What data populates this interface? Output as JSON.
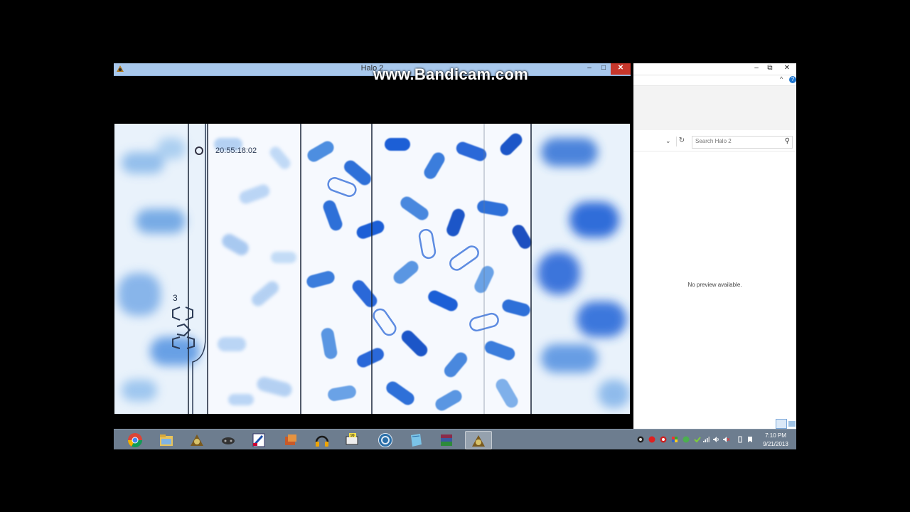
{
  "game_window": {
    "title": "Halo 2",
    "minimize_glyph": "–",
    "maximize_glyph": "□",
    "close_glyph": "✕"
  },
  "watermark": "www.Bandicam.com",
  "video": {
    "timecode": "20:55:18:02",
    "frame_counter": "3"
  },
  "taskbar": {
    "apps": [
      {
        "icon": "chrome-icon",
        "active": false
      },
      {
        "icon": "file-explorer-icon",
        "active": false
      },
      {
        "icon": "halo-icon",
        "active": false
      },
      {
        "icon": "gamepad-icon",
        "active": false
      },
      {
        "icon": "paint-icon",
        "active": false
      },
      {
        "icon": "media-icon",
        "active": false
      },
      {
        "icon": "headphones-icon",
        "active": false
      },
      {
        "icon": "fraps-icon",
        "active": false
      },
      {
        "icon": "steam-icon",
        "active": false
      },
      {
        "icon": "notepad-icon",
        "active": false
      },
      {
        "icon": "winrar-icon",
        "active": false
      },
      {
        "icon": "halo-icon",
        "active": true
      }
    ]
  },
  "explorer": {
    "minimize_glyph": "–",
    "maximize_glyph": "⧉",
    "close_glyph": "✕",
    "up_glyph": "^",
    "help_glyph": "?",
    "dropdown_glyph": "⌄",
    "refresh_glyph": "↻",
    "search_placeholder": "Search Halo 2",
    "search_glyph": "⚲",
    "no_preview": "No preview available."
  },
  "tray": {
    "time": "7:10 PM",
    "date": "9/21/2013"
  },
  "colors": {
    "taskbar": "#6d7d8f",
    "game_titlebar": "#a8c8ec",
    "close_red": "#c7372c",
    "video_light": "#eef5fc",
    "capsule_blue": "#1f5fd6"
  }
}
